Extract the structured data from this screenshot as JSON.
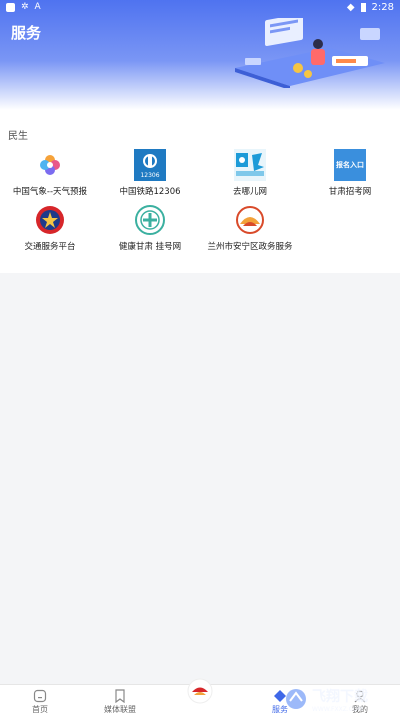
{
  "status_bar": {
    "time": "2:28"
  },
  "header": {
    "title": "服务"
  },
  "section": {
    "title": "民生"
  },
  "services": [
    {
      "label": "中国气象--天气预报",
      "icon": "weather-pinwheel-icon"
    },
    {
      "label": "中国铁路12306",
      "icon": "railway-12306-icon"
    },
    {
      "label": "去哪儿网",
      "icon": "qunar-icon"
    },
    {
      "label": "甘肃招考网",
      "icon": "gansu-exam-icon",
      "icon_text": "报名入口"
    },
    {
      "label": "交通服务平台",
      "icon": "police-emblem-icon"
    },
    {
      "label": "健康甘肃 挂号网",
      "icon": "health-gansu-icon"
    },
    {
      "label": "兰州市安宁区政务服务",
      "icon": "anning-government-icon"
    }
  ],
  "tabbar": {
    "items": [
      {
        "label": "首页",
        "icon": "home-icon"
      },
      {
        "label": "媒体联盟",
        "icon": "bookmark-icon"
      },
      {
        "label": "",
        "icon": "center-emblem-icon"
      },
      {
        "label": "服务",
        "icon": "service-icon",
        "active": true
      },
      {
        "label": "我的",
        "icon": "profile-icon"
      }
    ]
  },
  "watermark": {
    "text": "飞翔下载",
    "sub": "WWW.FXXZ.COM"
  },
  "colors": {
    "accent": "#3f68e8",
    "header_top": "#4f73f0"
  }
}
